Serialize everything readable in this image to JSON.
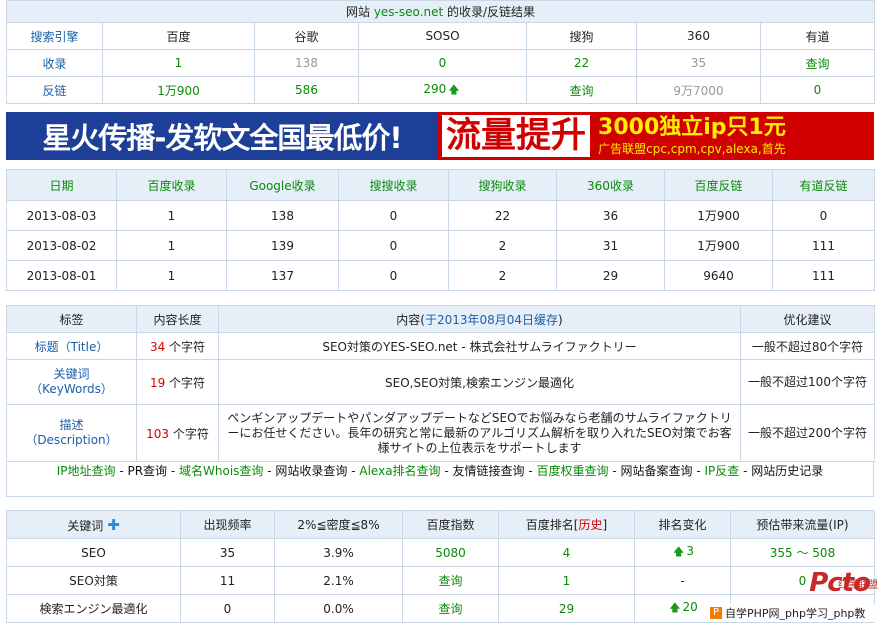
{
  "summary": {
    "title_prefix": "网站 ",
    "domain": "yes-seo.net",
    "title_suffix": " 的收录/反链结果",
    "header": [
      "搜索引擎",
      "百度",
      "谷歌",
      "SOSO",
      "搜狗",
      "360",
      "有道"
    ],
    "rows": [
      {
        "label": "收录",
        "cells": [
          "1",
          "138",
          "0",
          "22",
          "35",
          "查询"
        ]
      },
      {
        "label": "反链",
        "cells": [
          "1万900",
          "586",
          "290",
          "查询",
          "9万7000",
          "0"
        ]
      }
    ]
  },
  "banner": {
    "left_text": "星火传播-发软文全国最低价!",
    "right_big": "流量提升",
    "right_top": "3000独立ip只1元",
    "right_bottom": "广告联盟cpc,cpm,cpv,alexa,首先"
  },
  "history": {
    "header": [
      "日期",
      "百度收录",
      "Google收录",
      "搜搜收录",
      "搜狗收录",
      "360收录",
      "百度反链",
      "有道反链"
    ],
    "rows": [
      [
        "2013-08-03",
        "1",
        "138",
        "0",
        "22",
        "36",
        "1万900",
        "0"
      ],
      [
        "2013-08-02",
        "1",
        "139",
        "0",
        "2",
        "31",
        "1万900",
        "111"
      ],
      [
        "2013-08-01",
        "1",
        "137",
        "0",
        "2",
        "29",
        "9640",
        "111"
      ]
    ]
  },
  "meta": {
    "header": {
      "tag": "标签",
      "length": "内容长度",
      "content_prefix": "内容(",
      "content_link": "于2013年08月04日缓存",
      "content_suffix": ")",
      "advice": "优化建议"
    },
    "rows": [
      {
        "tag_main": "标题",
        "tag_sub": "（Title）",
        "count": "34",
        "unit": " 个字符",
        "content": "SEO対策のYES-SEO.net - 株式会社サムライファクトリー",
        "advice": "一般不超过80个字符"
      },
      {
        "tag_main": "关键词",
        "tag_sub": "（KeyWords）",
        "count": "19",
        "unit": " 个字符",
        "content": "SEO,SEO対策,検索エンジン最適化",
        "advice": "一般不超过100个字符"
      },
      {
        "tag_main": "描述",
        "tag_sub": "（Description）",
        "count": "103",
        "unit": " 个字符",
        "content": "ペンギンアップデートやパンダアップデートなどSEOでお悩みなら老舗のサムライファクトリーにお任せください。長年の研究と常に最新のアルゴリズム解析を取り入れたSEO対策でお客様サイトの上位表示をサポートします",
        "advice": "一般不超过200个字符"
      }
    ]
  },
  "links": [
    "IP地址查询",
    "PR查询",
    "域名Whois查询",
    "网站收录查询",
    "Alexa排名查询",
    "友情链接查询",
    "百度权重查询",
    "网站备案查询",
    "IP反查",
    "网站历史记录"
  ],
  "link_sep": " - ",
  "keywords": {
    "header": [
      "关键词",
      "出现频率",
      "2%≦密度≦8%",
      "百度指数",
      "百度排名",
      "排名变化",
      "预估带来流量(IP)"
    ],
    "rank_prefix": "百度排名[",
    "rank_link": "历史",
    "rank_suffix": "]",
    "rows": [
      {
        "kw": "SEO",
        "freq": "35",
        "density": "3.9%",
        "index": "5080",
        "rank": "4",
        "change": "3",
        "change_dir": "up",
        "traffic": "355 ～ 508"
      },
      {
        "kw": "SEO対策",
        "freq": "11",
        "density": "2.1%",
        "index": "查询",
        "rank": "1",
        "change": "-",
        "change_dir": "none",
        "traffic": "0"
      },
      {
        "kw": "検索エンジン最適化",
        "freq": "0",
        "density": "0.0%",
        "index": "查询",
        "rank": "29",
        "change": "20",
        "change_dir": "up",
        "traffic": ""
      }
    ]
  },
  "watermark": {
    "logo": "Pcto",
    "corner": "红黑联盟",
    "bar_icon": "P",
    "bar_text": "自学PHP网_php学习_php教"
  },
  "colors": {
    "header_bg": "#e6eff8",
    "link_green": "#0a8a0a",
    "link_blue": "#1a5fa8",
    "red": "#d40000",
    "banner_blue": "#1d3f98",
    "banner_red": "#d10000"
  },
  "icons": {
    "up": "arrow-up-icon",
    "plus": "plus-icon"
  }
}
